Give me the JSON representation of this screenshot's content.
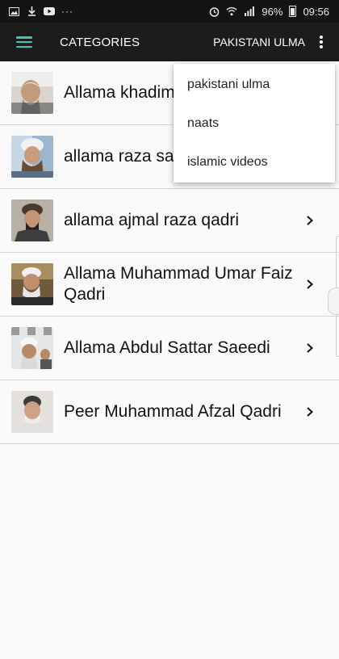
{
  "status_bar": {
    "left_icons": [
      "image-icon",
      "download-icon",
      "youtube-icon"
    ],
    "overflow": "···",
    "battery": "96%",
    "time": "09:56"
  },
  "app_bar": {
    "title": "CATEGORIES",
    "action": "PAKISTANI ULMA"
  },
  "list": {
    "items": [
      {
        "label": "Allama khadim",
        "thumb": "portrait-1"
      },
      {
        "label": "allama raza sa",
        "thumb": "portrait-2"
      },
      {
        "label": "allama ajmal raza qadri",
        "thumb": "portrait-3"
      },
      {
        "label": "Allama Muhammad Umar Faiz Qadri",
        "thumb": "portrait-4"
      },
      {
        "label": "Allama Abdul Sattar Saeedi",
        "thumb": "portrait-5"
      },
      {
        "label": "Peer Muhammad Afzal Qadri",
        "thumb": "portrait-6"
      }
    ]
  },
  "dropdown": {
    "items": [
      {
        "label": "pakistani ulma"
      },
      {
        "label": "naats"
      },
      {
        "label": "islamic videos"
      }
    ]
  },
  "colors": {
    "accent": "#3ec6b0",
    "app_bar": "#1c1c1c",
    "status_bar": "#141414"
  }
}
